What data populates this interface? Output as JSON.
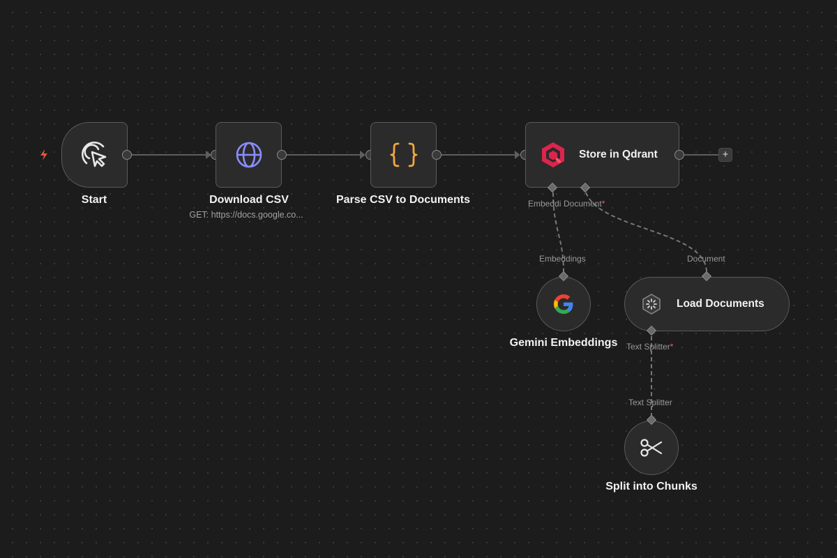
{
  "canvas": {
    "background": "#1c1c1c",
    "edge_color": "#5e5e5e",
    "required_color": "#ff5a5a"
  },
  "nodes": {
    "start": {
      "title": "Start",
      "icon": "cursor-click-icon"
    },
    "download": {
      "title": "Download CSV",
      "subtitle": "GET: https://docs.google.co...",
      "icon": "globe-icon",
      "icon_color": "#8b8dff"
    },
    "parse": {
      "title": "Parse CSV to Documents",
      "icon": "curly-braces-icon",
      "icon_color": "#f5a742"
    },
    "qdrant": {
      "title": "Store in Qdrant",
      "icon": "qdrant-logo-icon",
      "icon_color": "#dc244c"
    },
    "gemini": {
      "title": "Gemini Embeddings",
      "icon": "google-logo-icon"
    },
    "loader": {
      "title": "Load Documents",
      "icon": "document-loader-icon"
    },
    "splitter": {
      "title": "Split into Chunks",
      "icon": "scissors-icon"
    }
  },
  "ports": {
    "qdrant_embedding_label": "Embeddi",
    "qdrant_document_label": "Document",
    "required_mark": "*",
    "gemini_input_label": "Embeddings",
    "loader_input_label": "Document",
    "loader_text_splitter_label": "Text Splitter",
    "splitter_input_label": "Text Splitter"
  },
  "add_button_label": "+"
}
